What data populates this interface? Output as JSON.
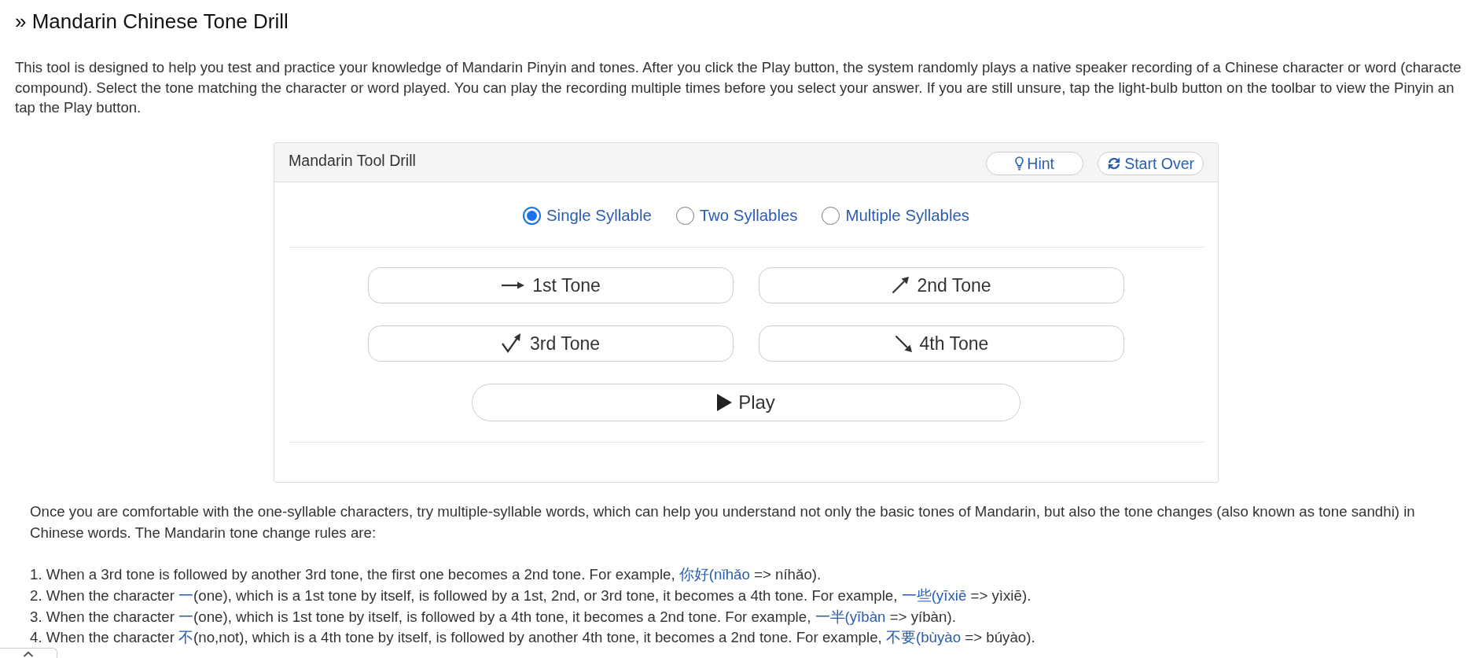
{
  "title": "» Mandarin Chinese Tone Drill",
  "intro": {
    "lines": [
      "This tool is designed to help you test and practice your knowledge of Mandarin Pinyin and tones. After you click the Play button, the system randomly plays a native speaker recording of a Chinese character or word (characte",
      "compound). Select the tone matching the character or word played. You can play the recording multiple times before you select your answer. If you are still unsure, tap the light-bulb button on the toolbar to view the Pinyin an",
      "tap the Play button."
    ]
  },
  "drill": {
    "title": "Mandarin Tool Drill",
    "toolbar": [
      {
        "label": "Hint"
      },
      {
        "label": "Start Over"
      }
    ],
    "syllable_options": [
      {
        "label": "Single Syllable",
        "selected": true
      },
      {
        "label": "Two Syllables",
        "selected": false
      },
      {
        "label": "Multiple Syllables",
        "selected": false
      }
    ],
    "tone_buttons": [
      {
        "label": "1st Tone"
      },
      {
        "label": "2nd Tone"
      },
      {
        "label": "3rd Tone"
      },
      {
        "label": "4th Tone"
      }
    ],
    "play_button": {
      "label": "Play"
    }
  },
  "notes": {
    "paragraph": "Once you are comfortable with the one-syllable characters, try multiple-syllable words, which can help you understand not only the basic tones of Mandarin, but also the tone changes (also known as tone sandhi) in Chinese words. The Mandarin tone change rules are:",
    "rules": [
      {
        "parts": [
          {
            "kind": "text",
            "text": "1. When a 3rd tone is followed by another 3rd tone, the first one becomes a 2nd tone. For example, "
          },
          {
            "kind": "link",
            "text": "你好(nǐhǎo"
          },
          {
            "kind": "text",
            "text": " => níhǎo)."
          }
        ]
      },
      {
        "parts": [
          {
            "kind": "text",
            "text": "2. When the character "
          },
          {
            "kind": "link",
            "text": "一"
          },
          {
            "kind": "text",
            "text": "(one), which is a 1st tone by itself, is followed by a 1st, 2nd, or 3rd tone, it becomes a 4th tone. For example, "
          },
          {
            "kind": "link",
            "text": "一些(yīxiē"
          },
          {
            "kind": "text",
            "text": " => yìxiē)."
          }
        ]
      },
      {
        "parts": [
          {
            "kind": "text",
            "text": "3. When the character "
          },
          {
            "kind": "link",
            "text": "一"
          },
          {
            "kind": "text",
            "text": "(one), which is 1st tone by itself, is followed by a 4th tone, it becomes a 2nd tone. For example, "
          },
          {
            "kind": "link",
            "text": "一半(yībàn"
          },
          {
            "kind": "text",
            "text": " => yíbàn)."
          }
        ]
      },
      {
        "parts": [
          {
            "kind": "text",
            "text": "4. When the character "
          },
          {
            "kind": "link",
            "text": "不"
          },
          {
            "kind": "text",
            "text": "(no,not), which is a 4th tone by itself, is followed by another 4th tone, it becomes a 2nd tone. For example, "
          },
          {
            "kind": "link",
            "text": "不要(bùyào"
          },
          {
            "kind": "text",
            "text": " => búyào)."
          }
        ]
      }
    ]
  }
}
